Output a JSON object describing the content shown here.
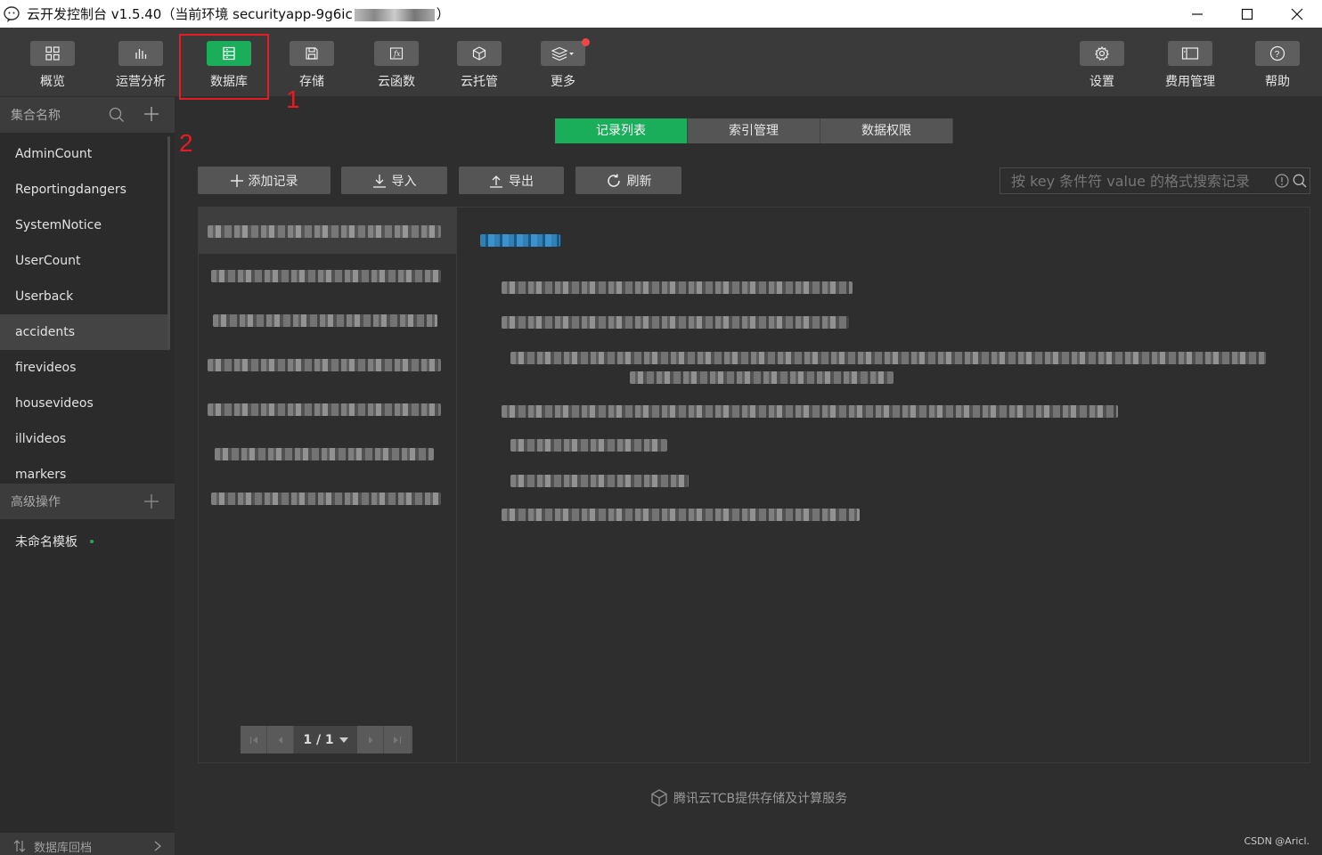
{
  "titlebar": {
    "title_prefix": "云开发控制台 v1.5.40（当前环境 securityapp-9g6ic",
    "title_suffix": "）"
  },
  "toolbar": {
    "items": [
      {
        "label": "概览",
        "icon": "grid-icon"
      },
      {
        "label": "运营分析",
        "icon": "bar-chart-icon"
      },
      {
        "label": "数据库",
        "icon": "database-icon"
      },
      {
        "label": "存储",
        "icon": "save-icon"
      },
      {
        "label": "云函数",
        "icon": "function-icon"
      },
      {
        "label": "云托管",
        "icon": "cube-icon"
      },
      {
        "label": "更多",
        "icon": "layers-icon"
      }
    ],
    "right_items": [
      {
        "label": "设置",
        "icon": "gear-icon"
      },
      {
        "label": "费用管理",
        "icon": "billing-icon"
      },
      {
        "label": "帮助",
        "icon": "help-icon"
      }
    ],
    "active": "数据库"
  },
  "annotations": {
    "one": "1",
    "two": "2"
  },
  "sidebar": {
    "collection_header": "集合名称",
    "collections": [
      "AdminCount",
      "Reportingdangers",
      "SystemNotice",
      "UserCount",
      "Userback",
      "accidents",
      "firevideos",
      "housevideos",
      "illvideos",
      "markers"
    ],
    "selected": "accidents",
    "advanced_header": "高级操作",
    "template_name": "未命名模板",
    "footer_label": "数据库回档"
  },
  "tabs": {
    "records": "记录列表",
    "indexes": "索引管理",
    "permissions": "数据权限"
  },
  "actions": {
    "add": "添加记录",
    "import": "导入",
    "export": "导出",
    "refresh": "刷新"
  },
  "search": {
    "placeholder": "按 key 条件符 value 的格式搜索记录"
  },
  "pager": {
    "page": "1 / 1"
  },
  "footer": {
    "text": "腾讯云TCB提供存储及计算服务"
  },
  "watermark": "CSDN @Aricl.",
  "colors": {
    "accent": "#1aad5a",
    "annotation": "#e51c23",
    "bg": "#2e2e2e"
  }
}
